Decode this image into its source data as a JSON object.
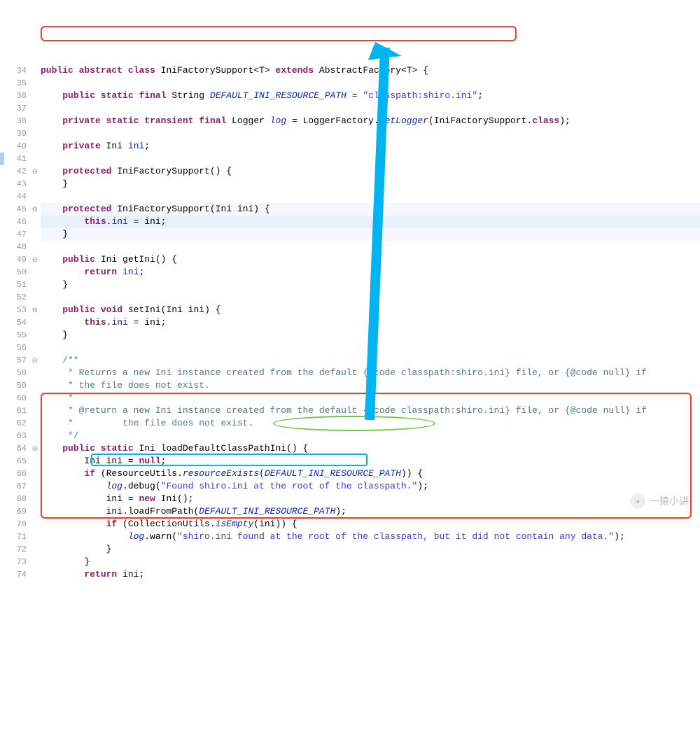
{
  "lines": {
    "34": {
      "indent": "",
      "segs": [
        [
          "kw",
          "public"
        ],
        [
          "",
          " "
        ],
        [
          "kw",
          "abstract"
        ],
        [
          "",
          " "
        ],
        [
          "kw",
          "class"
        ],
        [
          "",
          " IniFactorySupport<T> "
        ],
        [
          "kw",
          "extends"
        ],
        [
          "",
          " AbstractFactory<T> {"
        ]
      ]
    },
    "35": {
      "indent": "",
      "segs": []
    },
    "36": {
      "indent": "    ",
      "segs": [
        [
          "kw",
          "public"
        ],
        [
          "",
          " "
        ],
        [
          "kw",
          "static"
        ],
        [
          "",
          " "
        ],
        [
          "kw",
          "final"
        ],
        [
          "",
          " String "
        ],
        [
          "stat",
          "DEFAULT_INI_RESOURCE_PATH"
        ],
        [
          "",
          " = "
        ],
        [
          "str",
          "\"classpath:shiro.ini\""
        ],
        [
          "",
          ";"
        ]
      ]
    },
    "37": {
      "indent": "",
      "segs": []
    },
    "38": {
      "indent": "    ",
      "segs": [
        [
          "kw",
          "private"
        ],
        [
          "",
          " "
        ],
        [
          "kw",
          "static"
        ],
        [
          "",
          " "
        ],
        [
          "kw",
          "transient"
        ],
        [
          "",
          " "
        ],
        [
          "kw",
          "final"
        ],
        [
          "",
          " Logger "
        ],
        [
          "stat",
          "log"
        ],
        [
          "",
          " = LoggerFactory."
        ],
        [
          "stat",
          "getLogger"
        ],
        [
          "",
          "(IniFactorySupport."
        ],
        [
          "kw",
          "class"
        ],
        [
          "",
          ");"
        ]
      ]
    },
    "39": {
      "indent": "",
      "segs": []
    },
    "40": {
      "indent": "    ",
      "segs": [
        [
          "kw",
          "private"
        ],
        [
          "",
          " Ini "
        ],
        [
          "fld",
          "ini"
        ],
        [
          "",
          ";"
        ]
      ]
    },
    "41": {
      "indent": "",
      "segs": []
    },
    "42": {
      "indent": "    ",
      "segs": [
        [
          "kw",
          "protected"
        ],
        [
          "",
          " IniFactorySupport() {"
        ]
      ]
    },
    "43": {
      "indent": "    ",
      "segs": [
        [
          "",
          "}"
        ]
      ]
    },
    "44": {
      "indent": "",
      "segs": []
    },
    "45": {
      "indent": "    ",
      "segs": [
        [
          "kw",
          "protected"
        ],
        [
          "",
          " IniFactorySupport(Ini ini) {"
        ]
      ]
    },
    "46": {
      "indent": "        ",
      "segs": [
        [
          "kw",
          "this"
        ],
        [
          "",
          "."
        ],
        [
          "fld",
          "ini"
        ],
        [
          "",
          " = ini;"
        ]
      ]
    },
    "47": {
      "indent": "    ",
      "segs": [
        [
          "",
          "}"
        ]
      ]
    },
    "48": {
      "indent": "",
      "segs": []
    },
    "49": {
      "indent": "    ",
      "segs": [
        [
          "kw",
          "public"
        ],
        [
          "",
          " Ini getIni() {"
        ]
      ]
    },
    "50": {
      "indent": "        ",
      "segs": [
        [
          "kw",
          "return"
        ],
        [
          "",
          " "
        ],
        [
          "fld",
          "ini"
        ],
        [
          "",
          ";"
        ]
      ]
    },
    "51": {
      "indent": "    ",
      "segs": [
        [
          "",
          "}"
        ]
      ]
    },
    "52": {
      "indent": "",
      "segs": []
    },
    "53": {
      "indent": "    ",
      "segs": [
        [
          "kw",
          "public"
        ],
        [
          "",
          " "
        ],
        [
          "kw",
          "void"
        ],
        [
          "",
          " setIni(Ini ini) {"
        ]
      ]
    },
    "54": {
      "indent": "        ",
      "segs": [
        [
          "kw",
          "this"
        ],
        [
          "",
          "."
        ],
        [
          "fld",
          "ini"
        ],
        [
          "",
          " = ini;"
        ]
      ]
    },
    "55": {
      "indent": "    ",
      "segs": [
        [
          "",
          "}"
        ]
      ]
    },
    "56": {
      "indent": "",
      "segs": []
    },
    "57": {
      "indent": "    ",
      "segs": [
        [
          "cmt",
          "/**"
        ]
      ]
    },
    "58": {
      "indent": "     ",
      "segs": [
        [
          "cmt",
          "* Returns a new Ini instance created from the default {@code classpath:shiro.ini} file, or {@code null} if"
        ]
      ]
    },
    "59": {
      "indent": "     ",
      "segs": [
        [
          "cmt",
          "* the file does not exist."
        ]
      ]
    },
    "60": {
      "indent": "     ",
      "segs": [
        [
          "cmt",
          "*"
        ]
      ]
    },
    "61": {
      "indent": "     ",
      "segs": [
        [
          "cmt",
          "* @return a new Ini instance created from the default {@code classpath:shiro.ini} file, or {@code null} if"
        ]
      ]
    },
    "62": {
      "indent": "     ",
      "segs": [
        [
          "cmt",
          "*         the file does not exist."
        ]
      ]
    },
    "63": {
      "indent": "     ",
      "segs": [
        [
          "cmt",
          "*/"
        ]
      ]
    },
    "64": {
      "indent": "    ",
      "segs": [
        [
          "kw",
          "public"
        ],
        [
          "",
          " "
        ],
        [
          "kw",
          "static"
        ],
        [
          "",
          " Ini loadDefaultClassPathIni() {"
        ]
      ]
    },
    "65": {
      "indent": "        ",
      "segs": [
        [
          "",
          "Ini ini = "
        ],
        [
          "kw",
          "null"
        ],
        [
          "",
          ";"
        ]
      ]
    },
    "66": {
      "indent": "        ",
      "segs": [
        [
          "kw",
          "if"
        ],
        [
          "",
          " (ResourceUtils."
        ],
        [
          "stat",
          "resourceExists"
        ],
        [
          "",
          "("
        ],
        [
          "stat",
          "DEFAULT_INI_RESOURCE_PATH"
        ],
        [
          "",
          ")) {"
        ]
      ]
    },
    "67": {
      "indent": "            ",
      "segs": [
        [
          "stat",
          "log"
        ],
        [
          "",
          ".debug("
        ],
        [
          "str",
          "\"Found shiro.ini at the root of the classpath.\""
        ],
        [
          "",
          ");"
        ]
      ]
    },
    "68": {
      "indent": "            ",
      "segs": [
        [
          "",
          "ini = "
        ],
        [
          "kw",
          "new"
        ],
        [
          "",
          " Ini();"
        ]
      ]
    },
    "69": {
      "indent": "            ",
      "segs": [
        [
          "",
          "ini.loadFromPath("
        ],
        [
          "stat",
          "DEFAULT_INI_RESOURCE_PATH"
        ],
        [
          "",
          ");"
        ]
      ]
    },
    "70": {
      "indent": "            ",
      "segs": [
        [
          "kw",
          "if"
        ],
        [
          "",
          " (CollectionUtils."
        ],
        [
          "stat",
          "isEmpty"
        ],
        [
          "",
          "(ini)) {"
        ]
      ]
    },
    "71": {
      "indent": "                ",
      "segs": [
        [
          "stat",
          "log"
        ],
        [
          "",
          ".warn("
        ],
        [
          "str",
          "\"shiro.ini found at the root of the classpath, but it did not contain any data.\""
        ],
        [
          "",
          ");"
        ]
      ]
    },
    "72": {
      "indent": "            ",
      "segs": [
        [
          "",
          "}"
        ]
      ]
    },
    "73": {
      "indent": "        ",
      "segs": [
        [
          "",
          "}"
        ]
      ]
    },
    "74": {
      "indent": "        ",
      "segs": [
        [
          "kw",
          "return"
        ],
        [
          "",
          " ini;"
        ]
      ]
    }
  },
  "lineNumbers": [
    "34",
    "35",
    "36",
    "37",
    "38",
    "39",
    "40",
    "41",
    "42",
    "43",
    "44",
    "45",
    "46",
    "47",
    "48",
    "49",
    "50",
    "51",
    "52",
    "53",
    "54",
    "55",
    "56",
    "57",
    "58",
    "59",
    "60",
    "61",
    "62",
    "63",
    "64",
    "65",
    "66",
    "67",
    "68",
    "69",
    "70",
    "71",
    "72",
    "73",
    "74"
  ],
  "foldLines": [
    "42",
    "45",
    "49",
    "53",
    "57",
    "64"
  ],
  "watermark": {
    "icon": "◕",
    "text": "一猿小讲"
  }
}
